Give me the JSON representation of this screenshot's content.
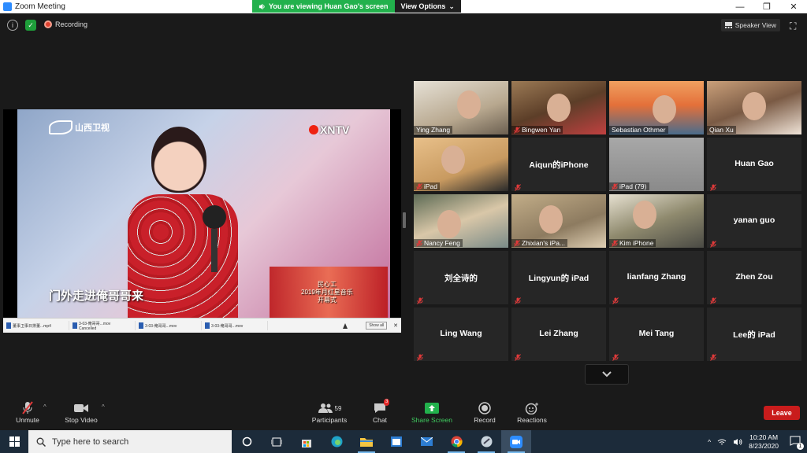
{
  "window": {
    "title": "Zoom Meeting",
    "controls": [
      "—",
      "❐",
      "✕"
    ]
  },
  "share_banner": {
    "message": "You are viewing Huan Gao's screen",
    "options_label": "View Options"
  },
  "top_bar": {
    "recording_label": "Recording",
    "speaker_view_label": "Speaker View"
  },
  "shared_screen": {
    "logo_left": "山西卫视",
    "logo_right": "XNTV",
    "subtitle": "门外走进俺哥哥来",
    "stage_caption_1": "民心工",
    "stage_caption_2": "2019年月红星音乐",
    "stage_caption_3": "开幕式",
    "downloads": [
      {
        "name": "董事卫事日排董...mp4",
        "sub": ""
      },
      {
        "name": "3-03-俺哥哥...mov",
        "sub": "Cancelled"
      },
      {
        "name": "3-03-俺哥哥...mov",
        "sub": ""
      },
      {
        "name": "3-03-俺哥哥...mov",
        "sub": ""
      }
    ],
    "downloads_show_all": "Show all",
    "downloads_close": "✕"
  },
  "participants_tiles": [
    {
      "name": "Ying Zhang",
      "video": true,
      "muted": false,
      "active": false
    },
    {
      "name": "Bingwen Yan",
      "video": true,
      "muted": true,
      "active": false
    },
    {
      "name": "Sebastian Othmer",
      "video": true,
      "muted": false,
      "active": false
    },
    {
      "name": "Qian Xu",
      "video": true,
      "muted": false,
      "active": true
    },
    {
      "name": "iPad",
      "video": true,
      "muted": true,
      "active": false
    },
    {
      "name": "Aiqun的iPhone",
      "video": false,
      "muted": true,
      "active": false
    },
    {
      "name": "iPad (79)",
      "video": true,
      "muted": true,
      "active": false
    },
    {
      "name": "Huan Gao",
      "video": false,
      "muted": true,
      "active": false
    },
    {
      "name": "Nancy Feng",
      "video": true,
      "muted": true,
      "active": false
    },
    {
      "name": "Zhixian's iPa...",
      "video": true,
      "muted": true,
      "active": false
    },
    {
      "name": "Kim iPhone",
      "video": true,
      "muted": true,
      "active": false
    },
    {
      "name": "yanan guo",
      "video": false,
      "muted": true,
      "active": false
    },
    {
      "name": "刘全诗的",
      "video": false,
      "muted": true,
      "active": false
    },
    {
      "name": "Lingyun的 iPad",
      "video": false,
      "muted": true,
      "active": false
    },
    {
      "name": "lianfang Zhang",
      "video": false,
      "muted": true,
      "active": false
    },
    {
      "name": "Zhen Zou",
      "video": false,
      "muted": true,
      "active": false
    },
    {
      "name": "Ling Wang",
      "video": false,
      "muted": true,
      "active": false
    },
    {
      "name": "Lei Zhang",
      "video": false,
      "muted": true,
      "active": false
    },
    {
      "name": "Mei Tang",
      "video": false,
      "muted": true,
      "active": false
    },
    {
      "name": "Lee的 iPad",
      "video": false,
      "muted": true,
      "active": false
    }
  ],
  "toolbar": {
    "unmute": "Unmute",
    "stop_video": "Stop Video",
    "participants": "Participants",
    "participants_count": "59",
    "chat": "Chat",
    "chat_badge": "3",
    "share_screen": "Share Screen",
    "record": "Record",
    "reactions": "Reactions",
    "leave": "Leave"
  },
  "taskbar": {
    "search_placeholder": "Type here to search",
    "time": "10:20 AM",
    "date": "8/23/2020",
    "notification_count": "1"
  },
  "colors": {
    "zoom_blue": "#2D8CFF",
    "share_green": "#22b14c",
    "leave_red": "#c91c1c",
    "active_speaker": "#e8d84a",
    "muted_red": "#e03a3a"
  }
}
